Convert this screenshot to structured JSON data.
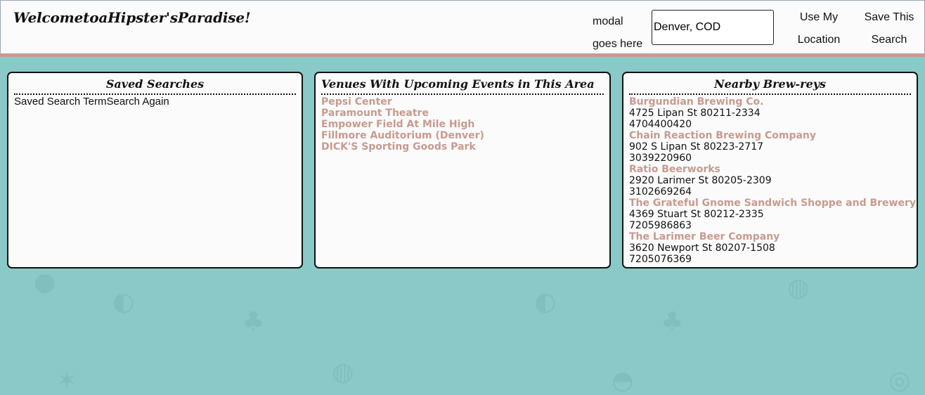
{
  "header": {
    "title": "WelcometoaHipster'sParadise!",
    "modal_line1": "modal",
    "modal_line2": "goes here",
    "location_value": "Denver, COD",
    "use_location_label": "Use My Location",
    "save_search_label": "Save This Search"
  },
  "saved_searches": {
    "title": "Saved Searches",
    "term": "Saved Search Term",
    "again_label": "Search Again"
  },
  "venues": {
    "title": "Venues With Upcoming Events in This Area",
    "items": [
      "Pepsi Center",
      "Paramount Theatre",
      "Empower Field At Mile High",
      "Fillmore Auditorium (Denver)",
      "DICK'S Sporting Goods Park"
    ]
  },
  "breweries": {
    "title": "Nearby Brew-reys",
    "items": [
      {
        "name": "Burgundian Brewing Co.",
        "address": "4725 Lipan St 80211-2334",
        "phone": "4704400420"
      },
      {
        "name": "Chain Reaction Brewing Company",
        "address": "902 S Lipan St 80223-2717",
        "phone": "3039220960"
      },
      {
        "name": "Ratio Beerworks",
        "address": "2920 Larimer St 80205-2309",
        "phone": "3102669264"
      },
      {
        "name": "The Grateful Gnome Sandwich Shoppe and Brewery",
        "address": "4369 Stuart St 80212-2335",
        "phone": "7205986863"
      },
      {
        "name": "The Larimer Beer Company",
        "address": "3620 Newport St 80207-1508",
        "phone": "7205076369"
      }
    ]
  },
  "colors": {
    "background": "#89c9c7",
    "accent": "#c89a8f",
    "panel": "#fbfbfb"
  },
  "decorations": [
    "balloon-icon",
    "shell-icon",
    "tree-icon",
    "grill-icon",
    "melon-icon",
    "pineapple-icon",
    "donut-icon"
  ]
}
